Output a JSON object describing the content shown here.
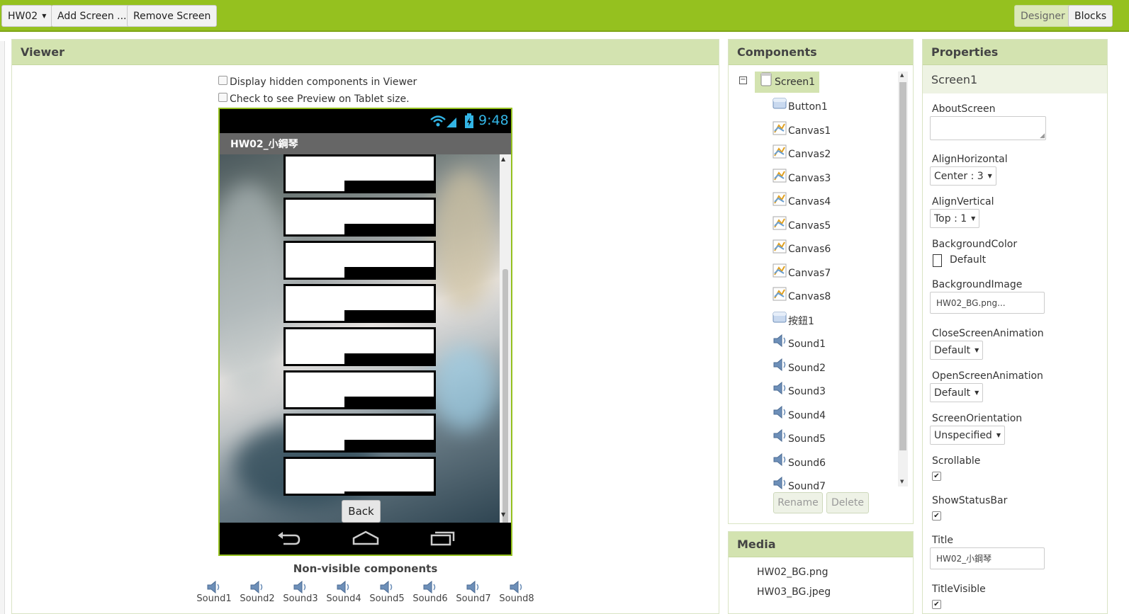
{
  "topbar": {
    "screen_select": "HW02",
    "add_screen": "Add Screen ...",
    "remove_screen": "Remove Screen",
    "designer": "Designer",
    "blocks": "Blocks"
  },
  "viewer": {
    "title": "Viewer",
    "hidden_components": "Display hidden components in Viewer",
    "tablet_preview": "Check to see Preview on Tablet size.",
    "phone_time": "9:48",
    "app_title": "HW02_小鋼琴",
    "back_button": "Back",
    "nonvisible_title": "Non-visible components",
    "nonvisible": [
      "Sound1",
      "Sound2",
      "Sound3",
      "Sound4",
      "Sound5",
      "Sound6",
      "Sound7",
      "Sound8"
    ]
  },
  "components": {
    "title": "Components",
    "root": "Screen1",
    "items": [
      {
        "label": "Button1",
        "icon": "button-icon"
      },
      {
        "label": "Canvas1",
        "icon": "canvas-icon"
      },
      {
        "label": "Canvas2",
        "icon": "canvas-icon"
      },
      {
        "label": "Canvas3",
        "icon": "canvas-icon"
      },
      {
        "label": "Canvas4",
        "icon": "canvas-icon"
      },
      {
        "label": "Canvas5",
        "icon": "canvas-icon"
      },
      {
        "label": "Canvas6",
        "icon": "canvas-icon"
      },
      {
        "label": "Canvas7",
        "icon": "canvas-icon"
      },
      {
        "label": "Canvas8",
        "icon": "canvas-icon"
      },
      {
        "label": "按鈕1",
        "icon": "button-icon"
      },
      {
        "label": "Sound1",
        "icon": "sound-icon"
      },
      {
        "label": "Sound2",
        "icon": "sound-icon"
      },
      {
        "label": "Sound3",
        "icon": "sound-icon"
      },
      {
        "label": "Sound4",
        "icon": "sound-icon"
      },
      {
        "label": "Sound5",
        "icon": "sound-icon"
      },
      {
        "label": "Sound6",
        "icon": "sound-icon"
      },
      {
        "label": "Sound7",
        "icon": "sound-icon"
      }
    ],
    "rename": "Rename",
    "delete": "Delete"
  },
  "media": {
    "title": "Media",
    "files": [
      "HW02_BG.png",
      "HW03_BG.jpeg"
    ]
  },
  "properties": {
    "title": "Properties",
    "component": "Screen1",
    "about_screen_label": "AboutScreen",
    "align_horizontal_label": "AlignHorizontal",
    "align_horizontal_value": "Center : 3",
    "align_vertical_label": "AlignVertical",
    "align_vertical_value": "Top : 1",
    "background_color_label": "BackgroundColor",
    "background_color_value": "Default",
    "background_image_label": "BackgroundImage",
    "background_image_value": "HW02_BG.png...",
    "close_anim_label": "CloseScreenAnimation",
    "close_anim_value": "Default",
    "open_anim_label": "OpenScreenAnimation",
    "open_anim_value": "Default",
    "orientation_label": "ScreenOrientation",
    "orientation_value": "Unspecified",
    "scrollable_label": "Scrollable",
    "statusbar_label": "ShowStatusBar",
    "title_label": "Title",
    "title_value": "HW02_小鋼琴",
    "title_visible_label": "TitleVisible"
  },
  "colors": {
    "accent": "#95c11f",
    "panel_header": "#d3e3b0"
  }
}
